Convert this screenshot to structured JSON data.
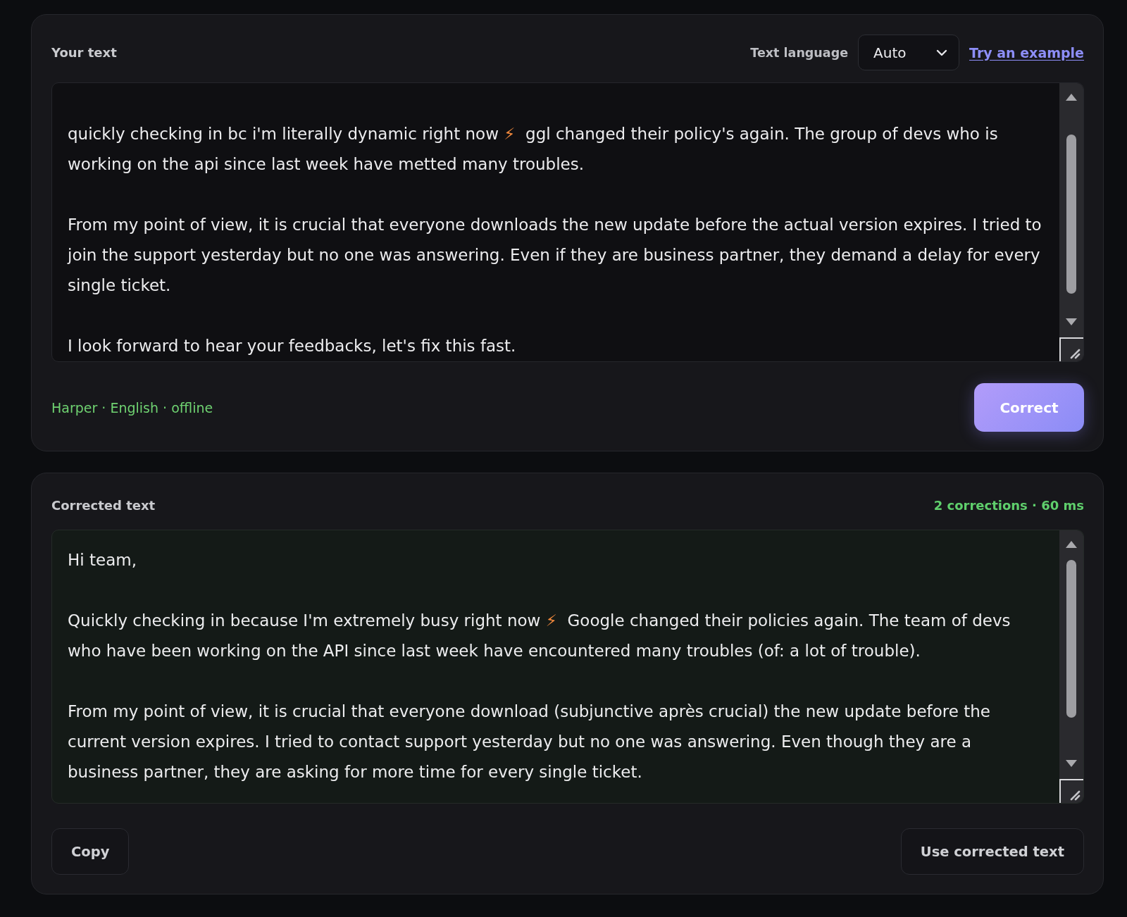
{
  "input_card": {
    "title": "Your text",
    "language_label": "Text language",
    "language_select": {
      "value": "Auto"
    },
    "example_link": "Try an example",
    "paragraphs": [
      {
        "parts": [
          {
            "kind": "text",
            "text": "quickly checking in bc i'm literally dynamic right now "
          },
          {
            "kind": "emoji",
            "text": "⚡"
          },
          {
            "kind": "text",
            "text": "  ggl changed their policy's again. The group of devs who is working on the api since last week have metted many troubles."
          }
        ]
      },
      {
        "parts": [
          {
            "kind": "text",
            "text": "From my point of view, it is crucial that everyone downloads the new update before the actual version expires. I tried to join the support yesterday but no one was answering. Even if they are business partner, they demand a delay for every single ticket."
          }
        ]
      },
      {
        "parts": [
          {
            "kind": "text",
            "text": "I look forward to hear your feedbacks, let's fix this fast."
          }
        ]
      }
    ],
    "engine_status": "Harper · English · offline",
    "correct_button": "Correct"
  },
  "output_card": {
    "title": "Corrected text",
    "stats": "2 corrections · 60 ms",
    "paragraphs": [
      {
        "parts": [
          {
            "kind": "text",
            "text": "Hi team,"
          }
        ]
      },
      {
        "parts": [
          {
            "kind": "text",
            "text": "Quickly checking in because I'm extremely busy right now "
          },
          {
            "kind": "emoji",
            "text": "⚡"
          },
          {
            "kind": "text",
            "text": "  Google changed their policies again. The team of devs who have been working on the API since last week have encountered many troubles (of: a lot of trouble)."
          }
        ]
      },
      {
        "parts": [
          {
            "kind": "text",
            "text": "From my point of view, it is crucial that everyone download (subjunctive après crucial) the new update before the current version expires. I tried to contact support yesterday but no one was answering. Even though they are a business partner, they are asking for more time for every single ticket."
          }
        ]
      }
    ],
    "buttons": [
      {
        "label": "Copy"
      },
      {
        "label": "Use corrected text"
      }
    ]
  }
}
